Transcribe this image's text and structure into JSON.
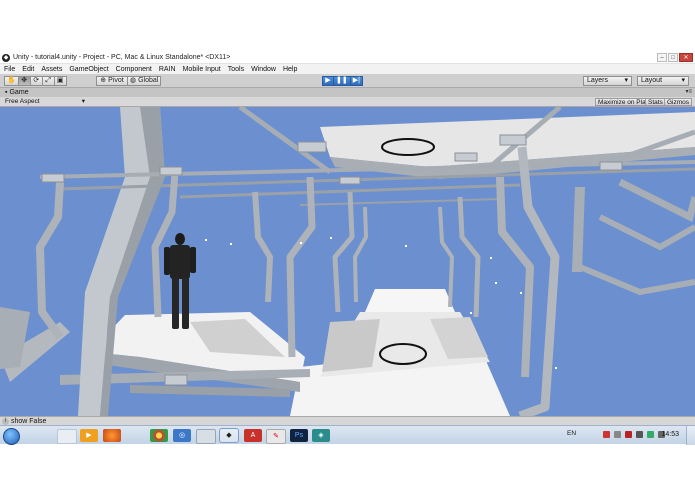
{
  "window": {
    "title": "Unity - tutorial4.unity - Project - PC, Mac & Linux Standalone* <DX11>",
    "app_icon": "unity-logo-icon",
    "controls": [
      "minimize-icon",
      "maximize-icon",
      "close-icon"
    ]
  },
  "menu": {
    "items": [
      "File",
      "Edit",
      "Assets",
      "GameObject",
      "Component",
      "RAIN",
      "Mobile Input",
      "Tools",
      "Window",
      "Help"
    ]
  },
  "toolbar": {
    "transform_tools": [
      "hand-icon",
      "move-icon",
      "rotate-icon",
      "scale-icon",
      "rect-tool-icon"
    ],
    "pivot_label": "Pivot",
    "global_label": "Global",
    "playback": [
      "play-icon",
      "pause-icon",
      "step-icon"
    ],
    "layers_label": "Layers",
    "layout_label": "Layout"
  },
  "game_view": {
    "tab_label": "Game",
    "tab_icon": "game-view-icon",
    "aspect_label": "Free Aspect",
    "maximize_label": "Maximize on Play",
    "stats_label": "Stats",
    "gizmos_label": "Gizmos"
  },
  "status": {
    "message": "show False"
  },
  "taskbar": {
    "language": "EN",
    "clock": "14:53",
    "icons": [
      "windows-start-icon",
      "file-icon",
      "media-player-icon",
      "firefox-icon",
      "chrome-icon",
      "network-icon",
      "document-icon",
      "unity-icon",
      "pdf-icon",
      "paint-icon",
      "photoshop-icon",
      "app-icon"
    ]
  },
  "colors": {
    "sky": "#6b8fcf",
    "structure": "#b8bdc4",
    "floor": "#f4f4f4",
    "play_active": "#3b7dd0"
  }
}
